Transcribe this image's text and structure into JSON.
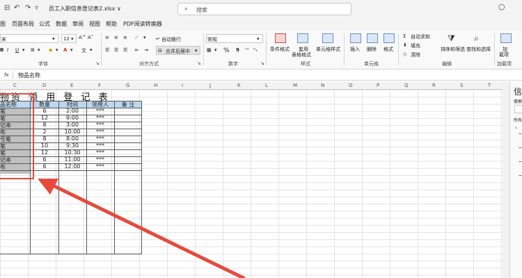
{
  "titlebar": {
    "file_name": "员工入职信息登记表2.xlsx ∨",
    "search_placeholder": "搜索"
  },
  "menu_tabs": [
    "图",
    "页面布局",
    "公式",
    "数据",
    "审阅",
    "视图",
    "帮助",
    "PDF阅读转换器"
  ],
  "ribbon": {
    "font_name": "宋",
    "font_size": "12",
    "grow_font": "A^",
    "shrink_font": "A˅",
    "bold": "B",
    "italic": "I",
    "underline": "U",
    "wrap_text": "自动换行",
    "merge_center": "合并后居中",
    "number_format": "常规",
    "percent": "%",
    "comma": "9",
    "conditional_format": "条件格式",
    "table_format_line1": "套用",
    "table_format_line2": "表格格式",
    "cell_styles": "单元格样式",
    "insert": "插入",
    "delete": "删除",
    "format": "格式",
    "autosum": "自动求和",
    "fill": "填充",
    "clear": "清除",
    "sort_filter": "排序和筛选",
    "find_select": "查找和选择",
    "addin_line1": "加",
    "addin_line2": "载项",
    "group_font": "字体",
    "group_align": "对齐方式",
    "group_number": "数字",
    "group_styles": "样式",
    "group_cells": "单元格",
    "group_editing": "编辑",
    "group_addins": "加载项"
  },
  "formula": {
    "fx": "fx",
    "content": "物品名称"
  },
  "columns": [
    "C",
    "D",
    "E",
    "F",
    "G",
    "H",
    "I",
    "J",
    "K",
    "L",
    "M",
    "N",
    "O",
    "P",
    "Q",
    "R",
    "S",
    "T"
  ],
  "sheet": {
    "title": "资 领 用 登 记 表",
    "title_fragment_left": "物",
    "headers": [
      "品名称",
      "数量",
      "时间",
      "领用人",
      "备 注"
    ],
    "rows": [
      [
        "笔",
        "6",
        "2:00",
        "***",
        ""
      ],
      [
        "笔",
        "12",
        "9:00",
        "***",
        ""
      ],
      [
        "记本",
        "8",
        "3:00",
        "***",
        ""
      ],
      [
        "布",
        "2",
        "10:00",
        "***",
        ""
      ],
      [
        "号笔",
        "8",
        "8:00",
        "***",
        ""
      ],
      [
        "笔",
        "10",
        "9:30",
        "***",
        ""
      ],
      [
        "笔",
        "12",
        "10:30",
        "***",
        ""
      ],
      [
        "记本",
        "6",
        "11:00",
        "***",
        ""
      ],
      [
        "布",
        "6",
        "12:00",
        "***",
        ""
      ]
    ]
  },
  "right_panel": {
    "title": "信",
    "search": "搜索",
    "filter": "所有"
  },
  "colors": {
    "annotation": "#e64a3c",
    "header_fill": "#bdd7ee",
    "selection_fill": "#c0c0c0"
  }
}
